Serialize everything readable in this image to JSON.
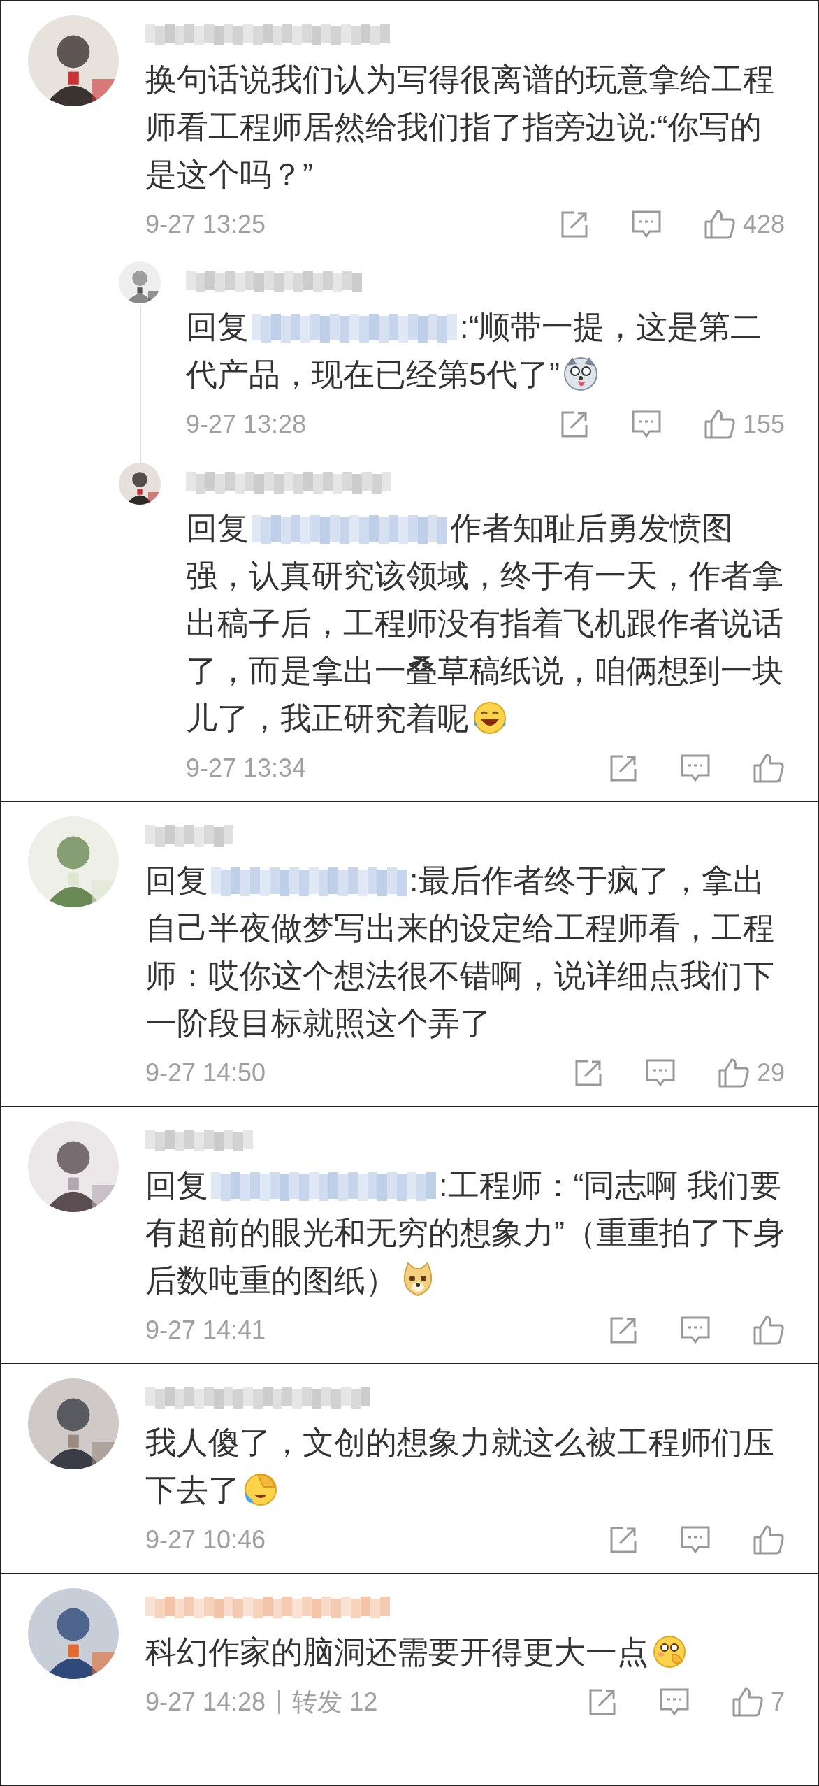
{
  "comments": [
    {
      "username": {
        "color": "#c8c8c8"
      },
      "text": "换句话说我们认为写得很离谱的玩意拿给工程师看工程师居然给我们指了指旁边说:“你写的是这个吗？”",
      "time": "9-27 13:25",
      "likes": "428",
      "replies": [
        {
          "username": {
            "color": "#c8c8c8"
          },
          "prefix": "回复",
          "mention": {
            "color": "#b9cbe6"
          },
          "text": ":“顺带一提，这是第二代产品，现在已经第5代了”",
          "emoji": {
            "kind": "husky"
          },
          "time": "9-27 13:28",
          "likes": "155"
        },
        {
          "username": {
            "color": "#c8c8c8"
          },
          "prefix": "回复",
          "mention": {
            "color": "#b9cbe6"
          },
          "text": "作者知耻后勇发愤图强，认真研究该领域，终于有一天，作者拿出稿子后，工程师没有指着飞机跟作者说话了，而是拿出一叠草稿纸说，咱俩想到一块儿了，我正研究着呢",
          "emoji": {
            "kind": "laugh"
          },
          "time": "9-27 13:34"
        }
      ]
    },
    {
      "username": {
        "color": "#c8c8c8"
      },
      "prefix": "回复",
      "mention": {
        "color": "#b9cbe6"
      },
      "text": ":最后作者终于疯了，拿出自己半夜做梦写出来的设定给工程师看，工程师：哎你这个想法很不错啊，说详细点我们下一阶段目标就照这个弄了",
      "time": "9-27 14:50",
      "likes": "29"
    },
    {
      "username": {
        "color": "#c8c8c8"
      },
      "prefix": "回复",
      "mention": {
        "color": "#b9cbe6"
      },
      "text": ":工程师：“同志啊 我们要有超前的眼光和无穷的想象力”（重重拍了下身后数吨重的图纸）",
      "emoji": {
        "kind": "doge"
      },
      "time": "9-27 14:41"
    },
    {
      "username": {
        "color": "#c8c8c8"
      },
      "text": "我人傻了，文创的想象力就这么被工程师们压下去了",
      "emoji": {
        "kind": "facepalm"
      },
      "time": "9-27 10:46"
    },
    {
      "username": {
        "color": "#f2bfa0"
      },
      "text": "科幻作家的脑洞还需要开得更大一点",
      "emoji": {
        "kind": "shy"
      },
      "time": "9-27 14:28",
      "reposts": {
        "label": "转发",
        "count": "12"
      },
      "likes": "7"
    }
  ]
}
